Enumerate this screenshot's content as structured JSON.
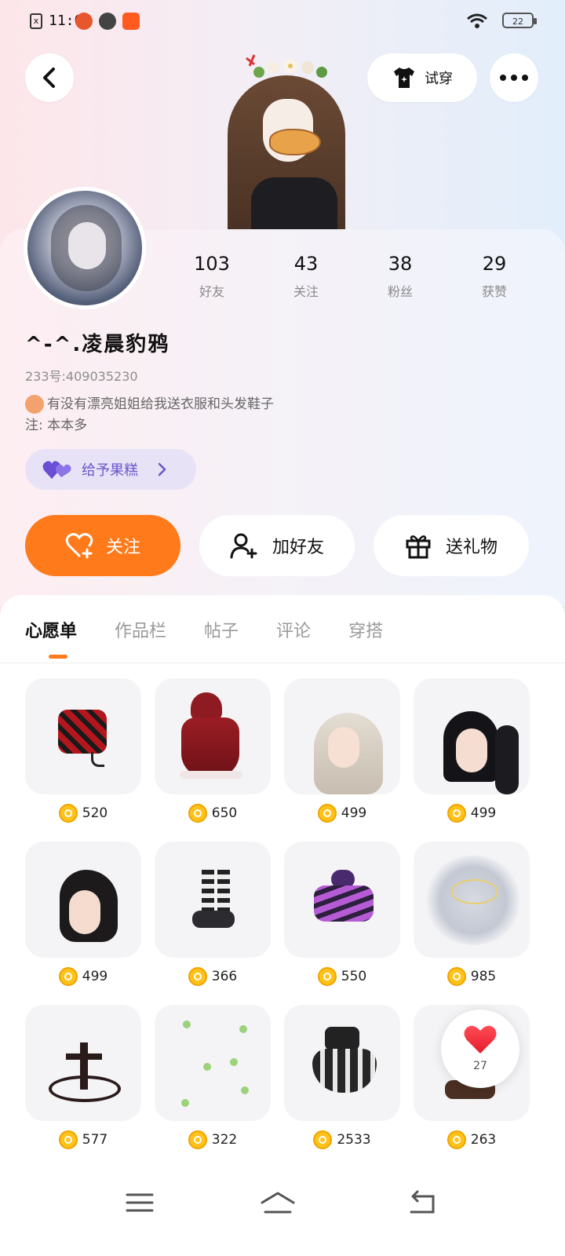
{
  "status_bar": {
    "time": "11:08",
    "battery": "22"
  },
  "header": {
    "try_on_label": "试穿"
  },
  "profile": {
    "nickname": "^-^.凌晨豹鸦",
    "uid": "233号:409035230",
    "bio": "有没有漂亮姐姐给我送衣服和头发鞋子",
    "note": "注: 本本多",
    "gift_pill_label": "给予果糕",
    "stats": [
      {
        "value": "103",
        "label": "好友"
      },
      {
        "value": "43",
        "label": "关注"
      },
      {
        "value": "38",
        "label": "粉丝"
      },
      {
        "value": "29",
        "label": "获赞"
      }
    ]
  },
  "actions": {
    "follow": "关注",
    "add_friend": "加好友",
    "send_gift": "送礼物"
  },
  "tabs": [
    {
      "label": "心愿单",
      "active": true
    },
    {
      "label": "作品栏",
      "active": false
    },
    {
      "label": "帖子",
      "active": false
    },
    {
      "label": "评论",
      "active": false
    },
    {
      "label": "穿搭",
      "active": false
    }
  ],
  "wishlist": [
    {
      "name": "red-plaid-jacket",
      "price": "520"
    },
    {
      "name": "red-hood-dress",
      "price": "650"
    },
    {
      "name": "blonde-long-hair",
      "price": "499"
    },
    {
      "name": "black-ponytail-hair",
      "price": "499"
    },
    {
      "name": "black-messy-bun-hair",
      "price": "499"
    },
    {
      "name": "striped-socks-boots",
      "price": "366"
    },
    {
      "name": "purple-cat-hoodie",
      "price": "550"
    },
    {
      "name": "cloud-halo-effect",
      "price": "985"
    },
    {
      "name": "dark-cross-ornament",
      "price": "577"
    },
    {
      "name": "clover-effect",
      "price": "322"
    },
    {
      "name": "gothic-lolita-dress",
      "price": "2533"
    },
    {
      "name": "brown-shoes",
      "price": "263"
    }
  ],
  "like_fab": {
    "count": "27"
  },
  "colors": {
    "accent": "#ff7a1a",
    "gift_purple": "#6a57c9",
    "coin": "#ffc21a"
  }
}
